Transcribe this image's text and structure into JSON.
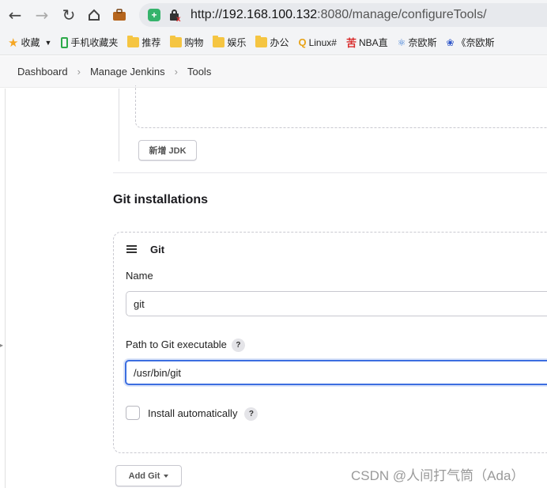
{
  "browser": {
    "url_scheme": "http://",
    "url_host": "192.168.100.132",
    "url_rest": ":8080/manage/configureTools/",
    "shield_icon": "shield-plus-icon",
    "security_icon": "insecure-lock-icon"
  },
  "bookmarks": [
    {
      "label": "收藏",
      "icon": "star-icon"
    },
    {
      "label": "手机收藏夹",
      "icon": "phone-icon"
    },
    {
      "label": "推荐",
      "icon": "folder-icon"
    },
    {
      "label": "购物",
      "icon": "folder-icon"
    },
    {
      "label": "娱乐",
      "icon": "folder-icon"
    },
    {
      "label": "办公",
      "icon": "folder-icon"
    },
    {
      "label": "Linux#",
      "icon": "q-icon"
    },
    {
      "label": "NBA直",
      "icon": "nba-icon"
    },
    {
      "label": "奈欧斯",
      "icon": "bookmark-icon"
    },
    {
      "label": "《奈欧斯",
      "icon": "paw-icon"
    }
  ],
  "breadcrumb": {
    "items": [
      "Dashboard",
      "Manage Jenkins",
      "Tools"
    ]
  },
  "jdk": {
    "add_button": "新增 JDK"
  },
  "git": {
    "section_title": "Git installations",
    "card_title": "Git",
    "name_label": "Name",
    "name_value": "git",
    "path_label": "Path to Git executable",
    "path_value": "/usr/bin/git",
    "install_label": "Install automatically",
    "help_glyph": "?",
    "add_button": "Add Git"
  },
  "watermark": "CSDN @人间打气筒（Ada）"
}
